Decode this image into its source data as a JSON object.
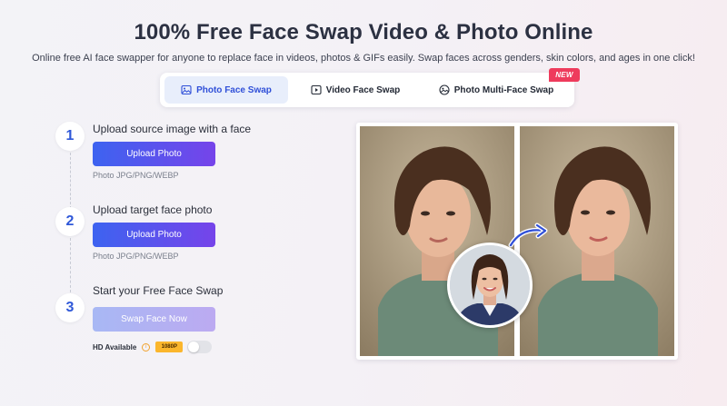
{
  "header": {
    "title": "100% Free Face Swap Video & Photo Online",
    "subtitle": "Online free AI face swapper for anyone to replace face in videos, photos & GIFs easily. Swap faces across genders, skin colors, and ages in one click!"
  },
  "tabs": [
    {
      "label": "Photo Face Swap",
      "icon": "image-icon",
      "active": true
    },
    {
      "label": "Video Face Swap",
      "icon": "video-icon",
      "active": false
    },
    {
      "label": "Photo Multi-Face Swap",
      "icon": "multi-image-icon",
      "active": false,
      "badge": "NEW"
    }
  ],
  "steps": [
    {
      "number": "1",
      "title": "Upload source image with a face",
      "button": "Upload Photo",
      "hint": "Photo JPG/PNG/WEBP"
    },
    {
      "number": "2",
      "title": "Upload target face photo",
      "button": "Upload Photo",
      "hint": "Photo JPG/PNG/WEBP"
    },
    {
      "number": "3",
      "title": "Start your Free Face Swap",
      "button": "Swap Face Now"
    }
  ],
  "hd": {
    "label": "HD Available",
    "badge": "1080P",
    "enabled": false
  },
  "colors": {
    "accent_start": "#3d63f0",
    "accent_end": "#7644ea",
    "step_number": "#2f58d8",
    "new_badge": "#ee3b5c",
    "hd_badge": "#fbb62c",
    "active_tab_bg": "#e8eefb"
  }
}
